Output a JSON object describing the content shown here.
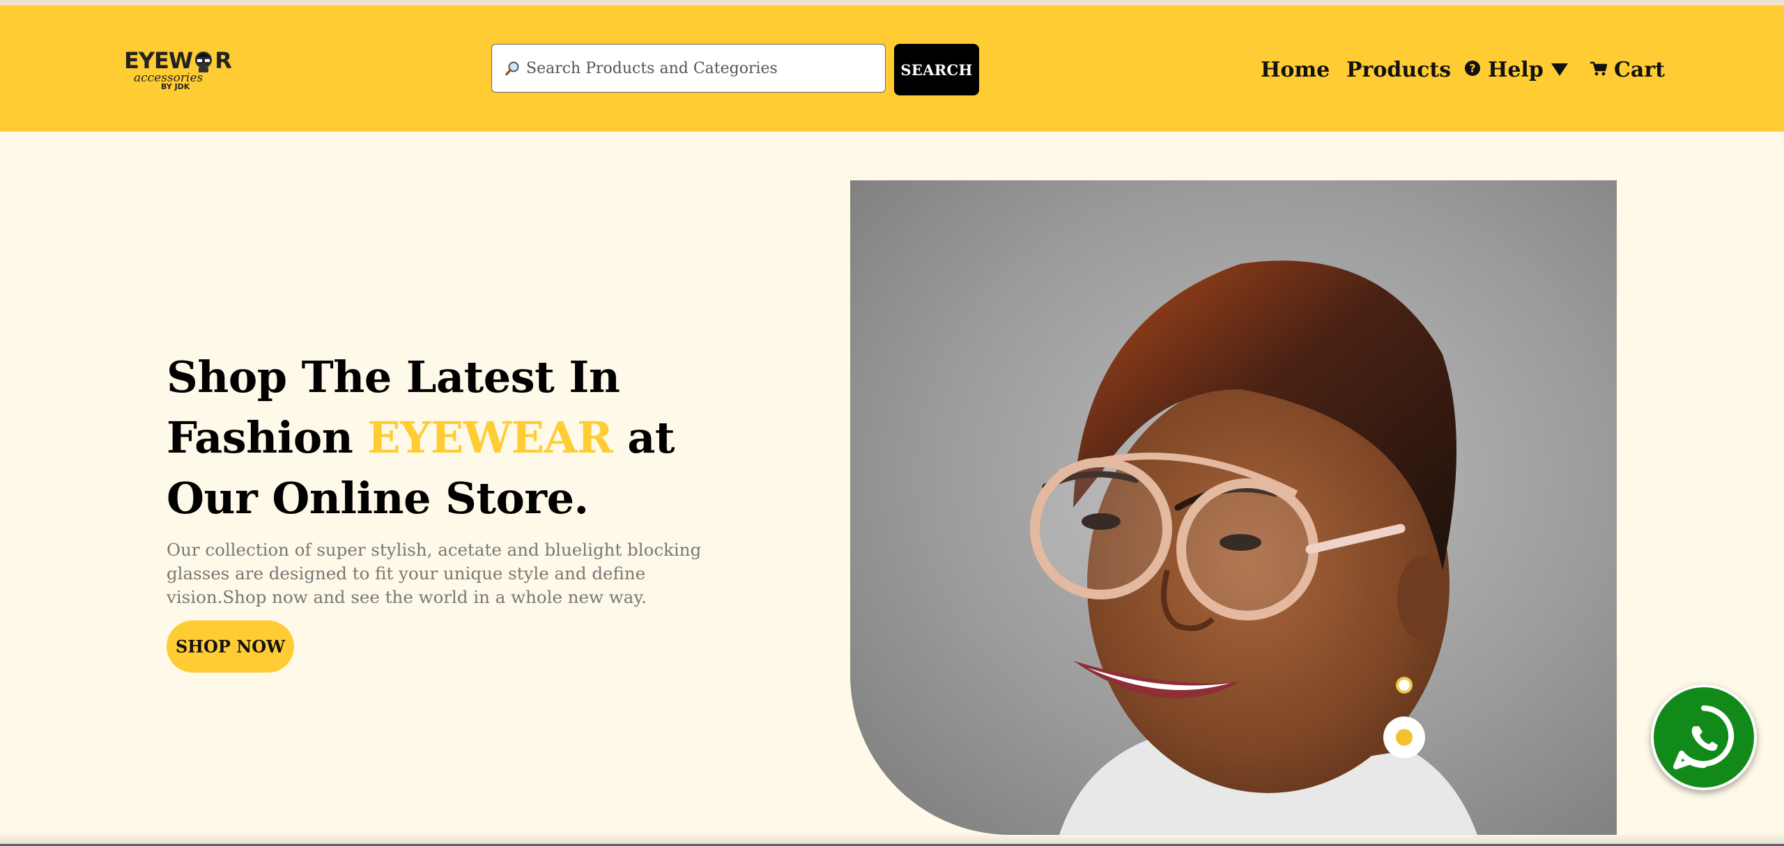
{
  "brand": {
    "logo_main_left": "EYEW",
    "logo_main_right": "R",
    "logo_sub": "accessories",
    "logo_by": "BY JDK"
  },
  "search": {
    "placeholder": "Search Products and Categories",
    "button_label": "SEARCH",
    "icon": "magnifier-icon"
  },
  "nav": {
    "home": "Home",
    "products": "Products",
    "help": "Help",
    "cart": "Cart",
    "help_icon": "question-circle-icon",
    "dropdown_icon": "caret-down-icon",
    "cart_icon": "cart-icon"
  },
  "hero": {
    "title_line1": "Shop The Latest In",
    "title_line2_pre": "Fashion ",
    "title_accent": "EYEWEAR",
    "title_line2_post": " at",
    "title_line3": "Our Online Store.",
    "description": "Our collection of super stylish, acetate and bluelight blocking glasses are designed to fit your unique style and define vision.Shop now and see the world in a whole new way.",
    "cta_label": "SHOP NOW"
  },
  "whatsapp": {
    "icon": "whatsapp-icon"
  },
  "colors": {
    "brand_yellow": "#ffcc33",
    "page_background": "#fef9e8",
    "search_button": "#000000",
    "whatsapp_green": "#128a1a",
    "description_gray": "#777777"
  }
}
